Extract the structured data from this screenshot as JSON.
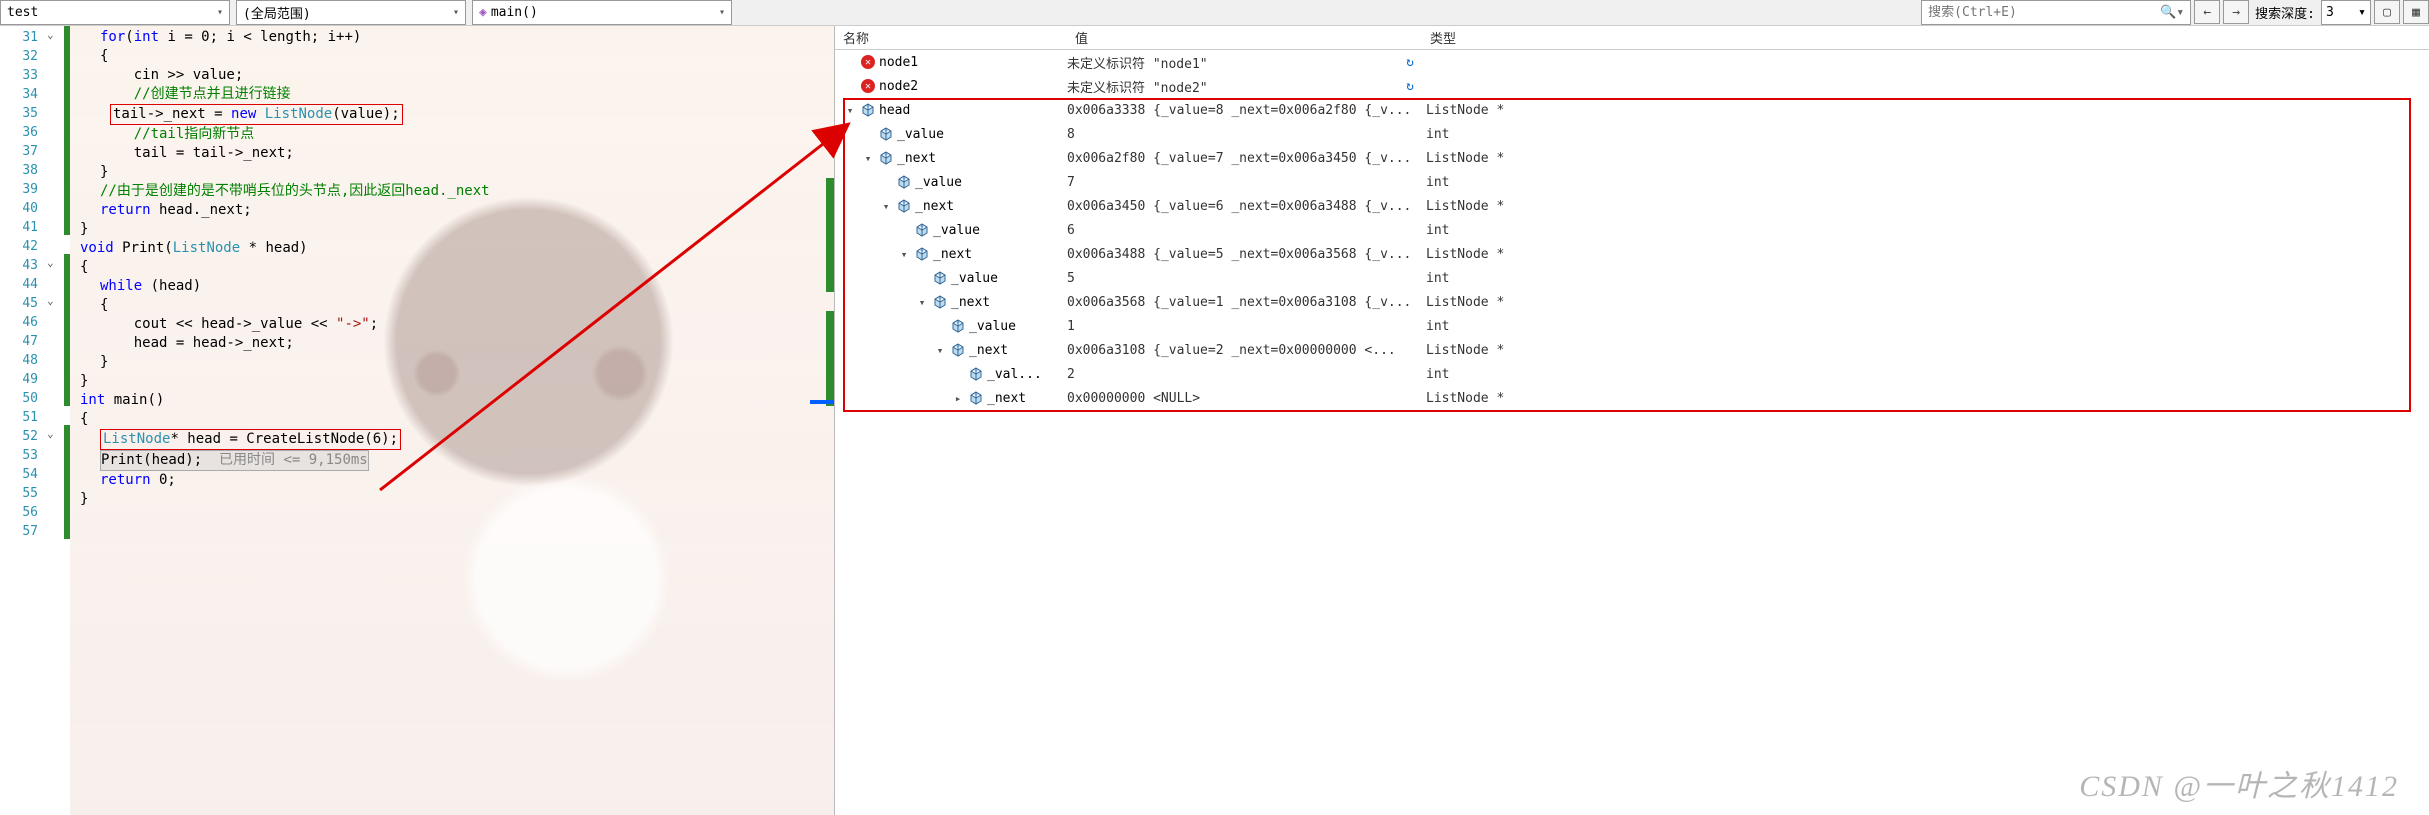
{
  "toolbar": {
    "scope_project": "test",
    "scope_global": "(全局范围)",
    "scope_function": "main()",
    "search_placeholder": "搜索(Ctrl+E)",
    "depth_label": "搜索深度:",
    "depth_value": "3"
  },
  "lines": {
    "start": 31,
    "end": 57
  },
  "code": {
    "l31": "for(int i = 0; i < length; i++)",
    "l32": "{",
    "l33": "    cin >> value;",
    "l34": "    //创建节点并且进行链接",
    "l35a": "    tail->_next = ",
    "l35b": "new",
    "l35c": " ListNode(value);",
    "l36": "    //tail指向新节点",
    "l37": "    tail = tail->_next;",
    "l38": "}",
    "l39": "//由于是创建的是不带哨兵位的头节点,因此返回head._next",
    "l40": "return head._next;",
    "l41": "}",
    "l43a": "void",
    "l43b": " Print(ListNode * head)",
    "l44": "{",
    "l45": "while (head)",
    "l46": "{",
    "l47a": "    cout << head->_value << ",
    "l47b": "\"->\"",
    "l47c": ";",
    "l48": "    head = head->_next;",
    "l49": "}",
    "l50": "}",
    "l52a": "int",
    "l52b": " main()",
    "l53": "{",
    "l54a": "ListNode* head = CreateListNode(",
    "l54b": "6",
    "l54c": ");",
    "l55a": "Print(head);",
    "l55b": "  已用时间 <= 9,150ms",
    "l56": "return 0;",
    "l57": "}"
  },
  "watch": {
    "headers": {
      "name": "名称",
      "value": "值",
      "type": "类型"
    },
    "rows": [
      {
        "depth": 0,
        "exp": "",
        "icon": "err",
        "name": "node1",
        "value": "未定义标识符 \"node1\"",
        "type": "",
        "refresh": true
      },
      {
        "depth": 0,
        "exp": "",
        "icon": "err",
        "name": "node2",
        "value": "未定义标识符 \"node2\"",
        "type": "",
        "refresh": true
      },
      {
        "depth": 0,
        "exp": "▾",
        "icon": "obj",
        "name": "head",
        "value": "0x006a3338 {_value=8 _next=0x006a2f80 {_v...",
        "type": "ListNode *"
      },
      {
        "depth": 1,
        "exp": "",
        "icon": "obj",
        "name": "_value",
        "value": "8",
        "type": "int"
      },
      {
        "depth": 1,
        "exp": "▾",
        "icon": "obj",
        "name": "_next",
        "value": "0x006a2f80 {_value=7 _next=0x006a3450 {_v...",
        "type": "ListNode *"
      },
      {
        "depth": 2,
        "exp": "",
        "icon": "obj",
        "name": "_value",
        "value": "7",
        "type": "int"
      },
      {
        "depth": 2,
        "exp": "▾",
        "icon": "obj",
        "name": "_next",
        "value": "0x006a3450 {_value=6 _next=0x006a3488 {_v...",
        "type": "ListNode *"
      },
      {
        "depth": 3,
        "exp": "",
        "icon": "obj",
        "name": "_value",
        "value": "6",
        "type": "int"
      },
      {
        "depth": 3,
        "exp": "▾",
        "icon": "obj",
        "name": "_next",
        "value": "0x006a3488 {_value=5 _next=0x006a3568 {_v...",
        "type": "ListNode *"
      },
      {
        "depth": 4,
        "exp": "",
        "icon": "obj",
        "name": "_value",
        "value": "5",
        "type": "int"
      },
      {
        "depth": 4,
        "exp": "▾",
        "icon": "obj",
        "name": "_next",
        "value": "0x006a3568 {_value=1 _next=0x006a3108 {_v...",
        "type": "ListNode *"
      },
      {
        "depth": 5,
        "exp": "",
        "icon": "obj",
        "name": "_value",
        "value": "1",
        "type": "int"
      },
      {
        "depth": 5,
        "exp": "▾",
        "icon": "obj",
        "name": "_next",
        "value": "0x006a3108 {_value=2 _next=0x00000000 <...",
        "type": "ListNode *"
      },
      {
        "depth": 6,
        "exp": "",
        "icon": "obj",
        "name": "_val...",
        "value": "2",
        "type": "int"
      },
      {
        "depth": 6,
        "exp": "▸",
        "icon": "obj",
        "name": "_next",
        "value": "0x00000000 <NULL>",
        "type": "ListNode *"
      }
    ]
  },
  "watermark": "CSDN @一叶之秋1412"
}
